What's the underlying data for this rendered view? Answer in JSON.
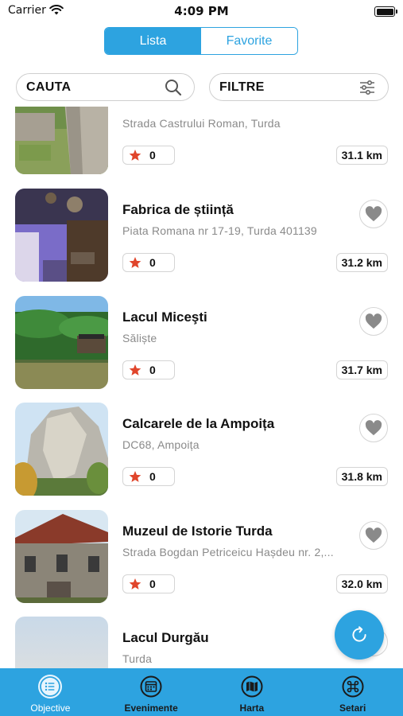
{
  "status_bar": {
    "carrier": "Carrier",
    "time": "4:09 PM"
  },
  "segmented": {
    "tabs": [
      {
        "label": "Lista",
        "active": true
      },
      {
        "label": "Favorite",
        "active": false
      }
    ]
  },
  "search": {
    "label": "CAUTA",
    "icon": "search-icon"
  },
  "filter": {
    "label": "FILTRE",
    "icon": "sliders-icon"
  },
  "places": [
    {
      "title": "",
      "address": "Strada Castrului Roman, Turda",
      "rating": "0",
      "distance": "31.1 km"
    },
    {
      "title": "Fabrica de știință",
      "address": "Piata Romana nr 17-19, Turda 401139",
      "rating": "0",
      "distance": "31.2 km"
    },
    {
      "title": "Lacul Miceşti",
      "address": "Săliște",
      "rating": "0",
      "distance": "31.7 km"
    },
    {
      "title": "Calcarele de la Ampoița",
      "address": "DC68, Ampoița",
      "rating": "0",
      "distance": "31.8 km"
    },
    {
      "title": "Muzeul de Istorie Turda",
      "address": "Strada Bogdan Petriceicu Hașdeu nr. 2,...",
      "rating": "0",
      "distance": "32.0 km"
    },
    {
      "title": "Lacul Durgău",
      "address": "Turda",
      "rating": "",
      "distance": ""
    }
  ],
  "tabbar": {
    "items": [
      {
        "label": "Objective",
        "icon": "list-icon",
        "active": true
      },
      {
        "label": "Evenimente",
        "icon": "calendar-icon",
        "active": false
      },
      {
        "label": "Harta",
        "icon": "map-icon",
        "active": false
      },
      {
        "label": "Setari",
        "icon": "command-icon",
        "active": false
      }
    ]
  },
  "colors": {
    "accent": "#2da3e0",
    "star": "#e0452b",
    "border": "#d4d4d4"
  }
}
